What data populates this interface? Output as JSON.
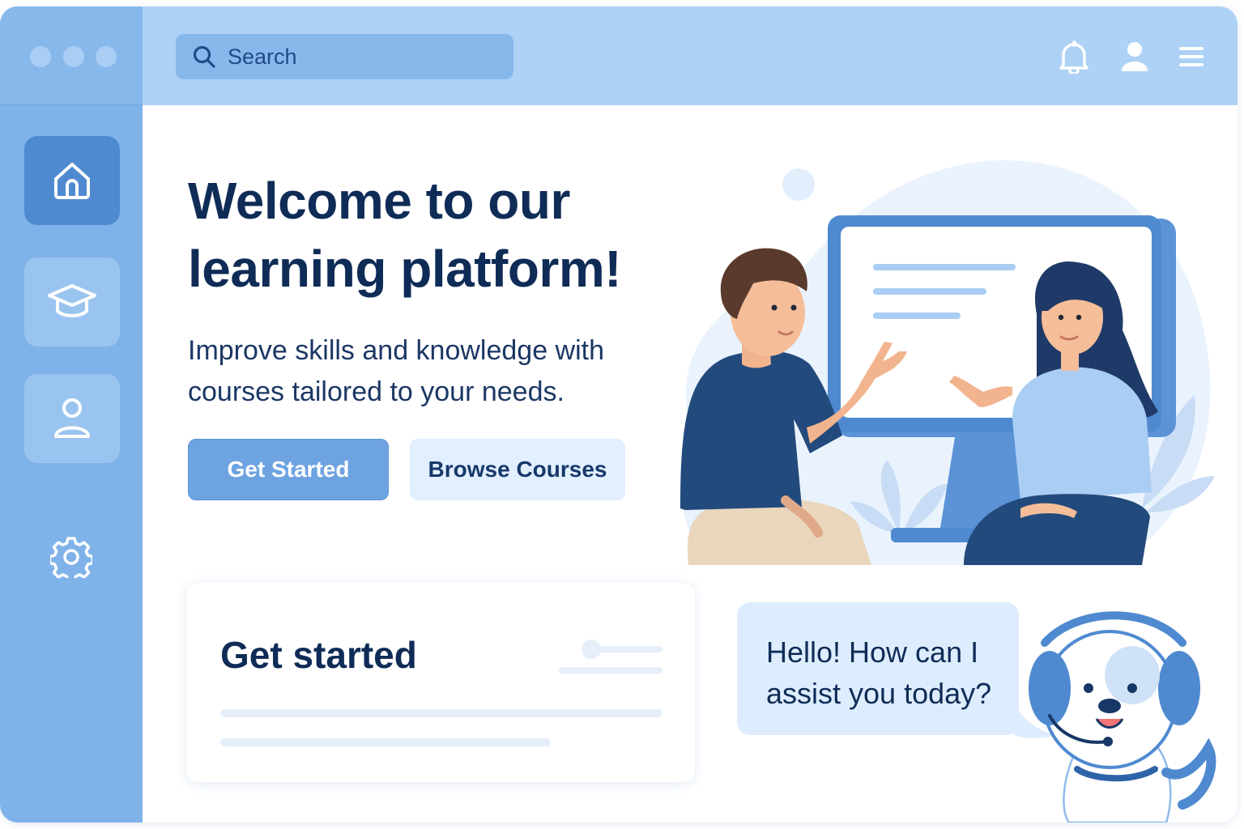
{
  "window": {
    "title": ""
  },
  "search": {
    "placeholder": "Search"
  },
  "sidebar": {
    "items": [
      {
        "name": "home",
        "icon": "home-icon"
      },
      {
        "name": "courses",
        "icon": "graduation-cap-icon"
      },
      {
        "name": "profile",
        "icon": "user-icon"
      },
      {
        "name": "settings",
        "icon": "gear-icon"
      }
    ]
  },
  "topbar_icons": [
    "bell-icon",
    "user-icon",
    "hamburger-menu-icon"
  ],
  "hero": {
    "title": "Welcome to our learning platform!",
    "subtitle": "Improve skills and knowledge with courses tailored to your needs.",
    "primary_button": "Get Started",
    "secondary_button": "Browse Courses"
  },
  "card": {
    "title": "Get started"
  },
  "chat": {
    "message": "Hello! How can I assist you today?"
  },
  "colors": {
    "sidebar": "#7fb2e8",
    "topbar": "#add2f6",
    "primary_button": "#6ea3e1",
    "heading": "#0f2c57",
    "chat_bubble": "#deedfd"
  }
}
